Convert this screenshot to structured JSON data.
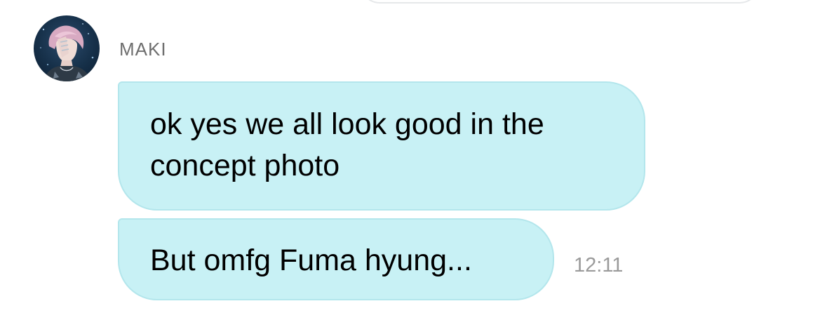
{
  "chat": {
    "sender": {
      "name": "MAKI",
      "avatar": "avatar-photo"
    },
    "messages": [
      {
        "text": "ok yes we all look good in the concept photo"
      },
      {
        "text": "But omfg Fuma hyung...",
        "time": "12:11"
      }
    ]
  },
  "colors": {
    "bubble_background": "#c8f1f5",
    "bubble_border": "#b3e6ec",
    "sender_name": "#6e6e6e",
    "timestamp": "#9a9a9a"
  }
}
